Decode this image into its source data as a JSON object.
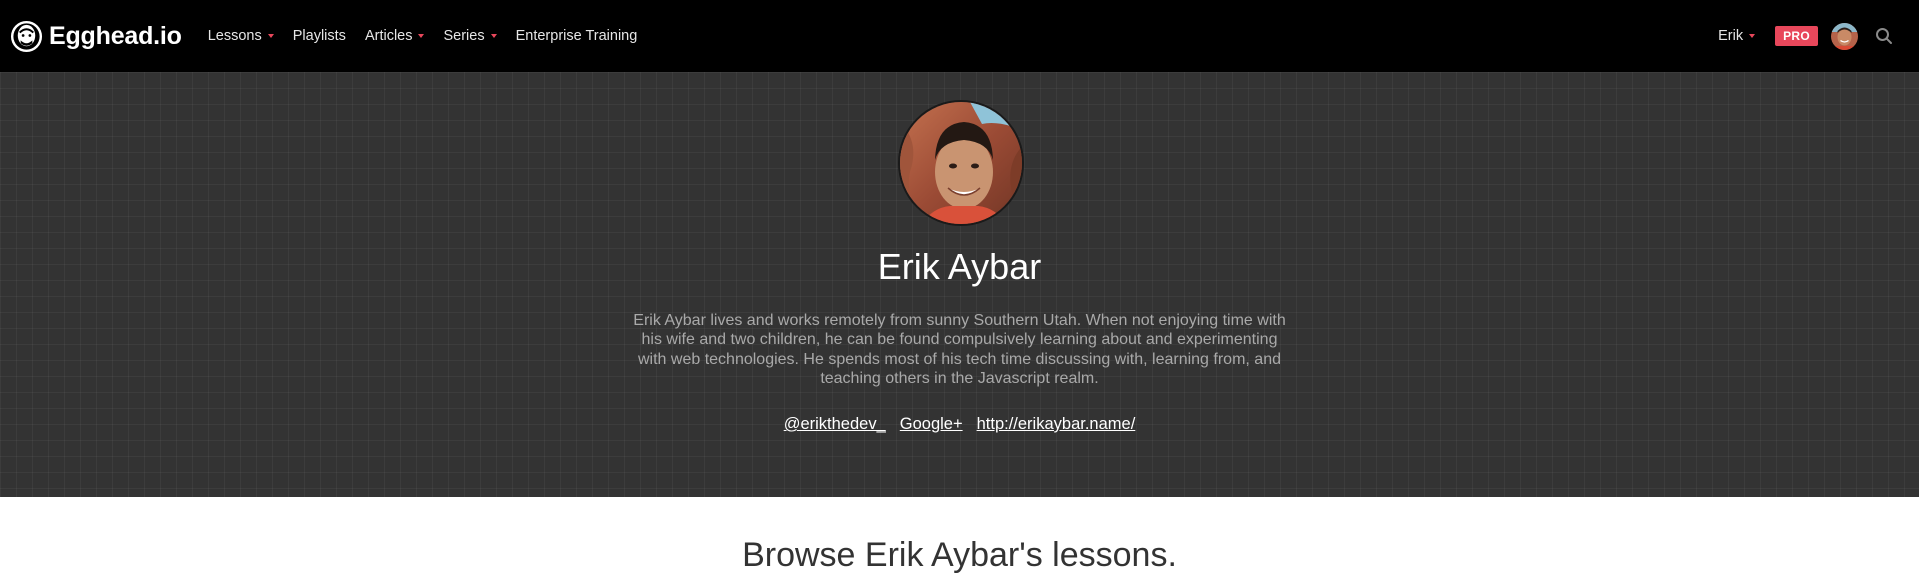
{
  "brand": {
    "name": "Egghead.io",
    "logo_icon": "egghead-logo-icon"
  },
  "nav": {
    "items": [
      {
        "label": "Lessons",
        "has_dropdown": true
      },
      {
        "label": "Playlists",
        "has_dropdown": false
      },
      {
        "label": "Articles",
        "has_dropdown": true
      },
      {
        "label": "Series",
        "has_dropdown": true
      },
      {
        "label": "Enterprise Training",
        "has_dropdown": false
      }
    ]
  },
  "user": {
    "name": "Erik",
    "badge": "PRO",
    "avatar_icon": "user-avatar",
    "search_icon": "search-icon"
  },
  "profile": {
    "name": "Erik Aybar",
    "bio": "Erik Aybar lives and works remotely from sunny Southern Utah. When not enjoying time with his wife and two children, he can be found compulsively learning about and experimenting with web technologies. He spends most of his tech time discussing with, learning from, and teaching others in the Javascript realm.",
    "links": [
      "@erikthedev_",
      "Google+",
      "http://erikaybar.name/"
    ]
  },
  "browse": {
    "heading": "Browse Erik Aybar's lessons."
  },
  "colors": {
    "accent": "#e8475b",
    "topbar": "#000000",
    "hero": "#333333",
    "bio_text": "#a9a9a9"
  }
}
